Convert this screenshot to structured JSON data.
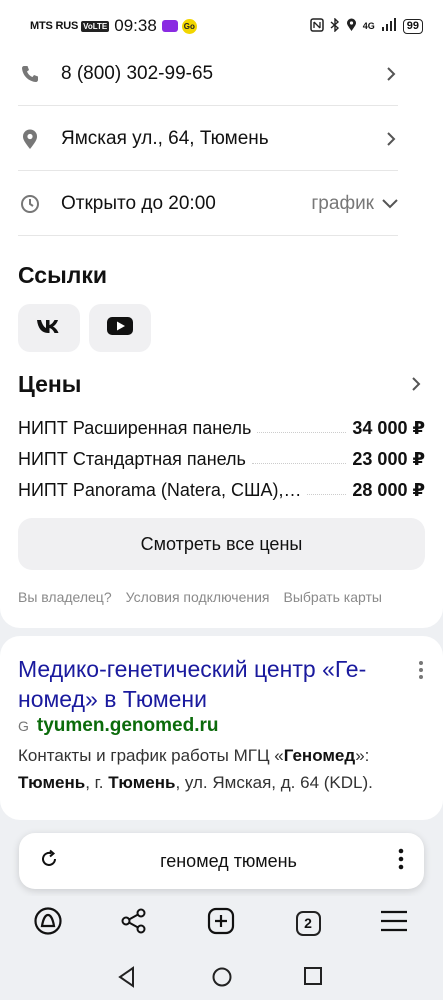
{
  "status_bar": {
    "carrier": "MTS RUS",
    "volte": "VoLTE",
    "time": "09:38",
    "badge2": "Go",
    "network": "4G",
    "battery": "99"
  },
  "contacts": {
    "phone": "8 (800) 302-99-65",
    "address": "Ямская ул., 64, Тюмень",
    "hours": "Открыто до 20:00",
    "schedule_label": "график"
  },
  "links": {
    "title": "Ссылки",
    "items": [
      {
        "name": "vk",
        "label": "VK"
      },
      {
        "name": "youtube",
        "label": "YouTube"
      }
    ]
  },
  "prices": {
    "title": "Цены",
    "items": [
      {
        "name": "НИПТ Расширенная панель",
        "value": "34 000 ₽"
      },
      {
        "name": "НИПТ Стандартная панель",
        "value": "23 000 ₽"
      },
      {
        "name": "НИПТ Panorama (Natera, США),…",
        "value": "28 000 ₽"
      }
    ],
    "all_button": "Смотреть все цены"
  },
  "footer_links": [
    "Вы владелец?",
    "Условия подключения",
    "Выбрать карты"
  ],
  "result": {
    "title": "Медико-генетический центр «Ге­номед» в Тюмени",
    "favicon": "G",
    "url": "tyumen.genomed.ru",
    "snippet_html_parts": [
      "Контакты и график работы МГЦ «",
      "Геномед",
      "»: ",
      "Тюмень",
      ", г. ",
      "Тюмень",
      ", ул. Ямская, д. 64 (KDL)."
    ]
  },
  "search": {
    "query": "геномед тюмень"
  },
  "bottom_nav": {
    "tabs_count": "2"
  },
  "colors": {
    "title_link": "#1a1a9e",
    "url_green": "#0b6b0b",
    "background": "#eef0f3"
  }
}
